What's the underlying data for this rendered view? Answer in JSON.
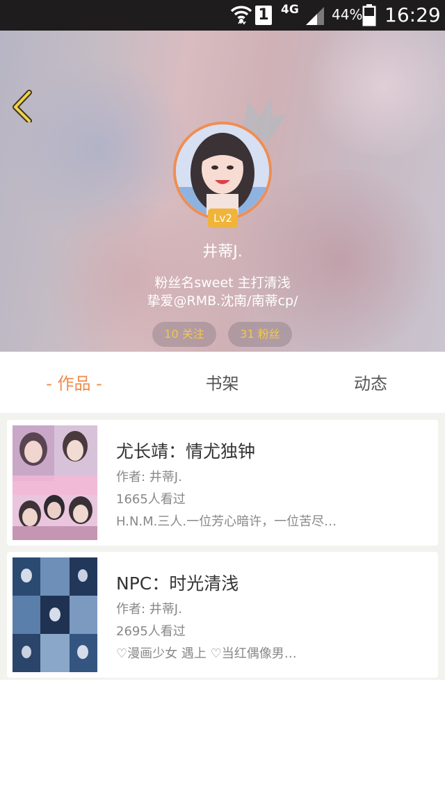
{
  "status_bar": {
    "sim_slot": "1",
    "network": "4G",
    "battery_percent": "44%",
    "time": "16:29",
    "icons": [
      "wifi-icon",
      "sim-icon",
      "signal-icon",
      "battery-icon"
    ]
  },
  "header": {
    "back_icon": "chevron-left-icon",
    "crown_icon": "crown-icon",
    "level": "Lv2",
    "username": "井蒂J.",
    "bio_line1": "粉丝名sweet  主打清浅",
    "bio_line2": "挚爱@RMB.沈南/南蒂cp/",
    "following": "10 关注",
    "fans": "31 粉丝"
  },
  "tabs": {
    "works": "- 作品 -",
    "shelf": "书架",
    "activity": "动态"
  },
  "books": [
    {
      "title": "尤长靖：情尤独钟",
      "author": "作者: 井蒂J.",
      "views": "1665人看过",
      "description": "H.N.M.三人.一位芳心暗许，一位苦尽…"
    },
    {
      "title": "NPC：时光清浅",
      "author": "作者: 井蒂J.",
      "views": "2695人看过",
      "description": "♡漫画少女 遇上 ♡当红偶像男…"
    }
  ],
  "colors": {
    "accent": "#f08a4b",
    "level_badge": "#f0b43a",
    "stat_text": "#f3c84a",
    "status_bar": "#1e1c1d"
  }
}
